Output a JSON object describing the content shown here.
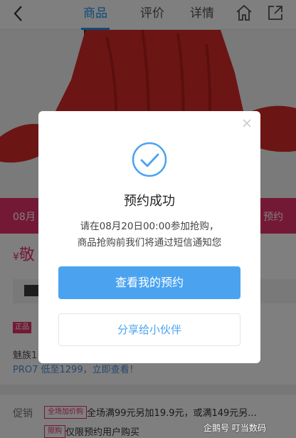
{
  "nav": {
    "tabs": [
      "商品",
      "评价",
      "详情"
    ],
    "active_tab": 0
  },
  "product": {
    "promo_date_text": "08月",
    "promo_right_text": "预约",
    "price_text": "敬",
    "price_symbol": "¥",
    "genuine_tag": "正品",
    "desc_line1": "魅族1",
    "desc_line2": "PRO7 低至1299，立即查看！"
  },
  "promotions": {
    "label": "促销",
    "items": [
      {
        "tag": "全场加价购",
        "text": "全场满99元另加19.9元，或满149元另..."
      },
      {
        "tag": "限购",
        "text": "仅限预约用户购买"
      }
    ]
  },
  "watermark": "企鹅号 叮当数码",
  "modal": {
    "title": "预约成功",
    "line1": "请在08月20日00:00参加抢购，",
    "line2": "商品抢购前我们将通过短信通知您",
    "primary_button": "查看我的预约",
    "secondary_button": "分享给小伙伴"
  },
  "colors": {
    "accent_blue": "#2196f3",
    "button_blue": "#4ba3f0",
    "brand_pink": "#e8336b",
    "product_red": "#d92b2b"
  },
  "icons": {
    "back": "chevron-left-icon",
    "home": "home-icon",
    "share": "share-external-icon",
    "close": "close-icon",
    "success": "check-circle-icon"
  }
}
